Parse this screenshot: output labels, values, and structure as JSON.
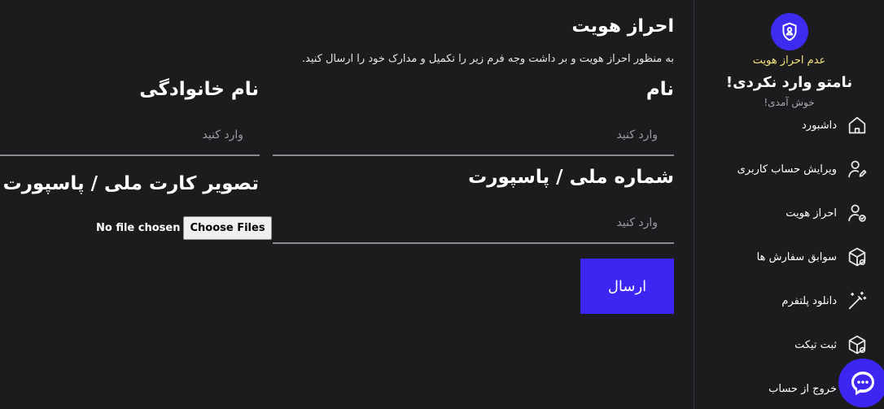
{
  "sidebar": {
    "verify_status": "عدم احراز هویت",
    "user_name": "نامتو وارد نکردی!",
    "welcome": "خوش آمدی!",
    "items": [
      {
        "label": "داشبورد",
        "icon": "home-icon"
      },
      {
        "label": "ویرایش حساب کاربری",
        "icon": "user-edit-icon"
      },
      {
        "label": "احراز هویت",
        "icon": "user-check-icon"
      },
      {
        "label": "سوابق سفارش ها",
        "icon": "box-icon"
      },
      {
        "label": "دانلود پلتفرم",
        "icon": "magic-wand-icon"
      },
      {
        "label": "ثبت تیکت",
        "icon": "box-edit-icon"
      },
      {
        "label": "خروج از حساب",
        "icon": "logout-icon"
      }
    ]
  },
  "main": {
    "title": "احراز هویت",
    "description": "به منظور احراز هویت و بر داشت وجه فرم زیر را تکمیل و مدارک خود را ارسال کنید.",
    "first_name": {
      "label": "نام",
      "placeholder": "وارد کنید"
    },
    "last_name": {
      "label": "نام خانوادگی",
      "placeholder": "وارد کنید"
    },
    "national_id": {
      "label": "شماره ملی / پاسپورت",
      "placeholder": "وارد کنید"
    },
    "id_image": {
      "label": "تصویر کارت ملی / پاسپورت",
      "button": "Choose Files",
      "status": "No file chosen"
    },
    "submit": "ارسال"
  },
  "colors": {
    "background": "#1c1c1f",
    "accent": "#3d25f2",
    "warning": "#f4e37a"
  }
}
